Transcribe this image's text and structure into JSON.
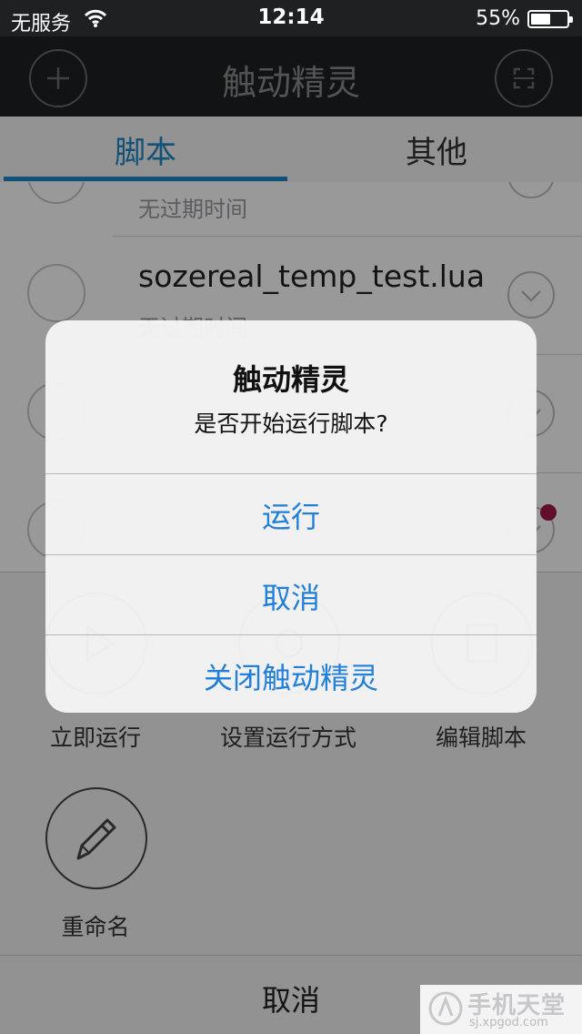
{
  "status_bar": {
    "carrier": "无服务",
    "time": "12:14",
    "battery_percent": "55%",
    "battery_level": 0.55
  },
  "nav": {
    "title": "触动精灵",
    "left_icon": "plus-icon",
    "right_icon": "scan-icon"
  },
  "tabs": [
    {
      "label": "脚本",
      "active": true
    },
    {
      "label": "其他",
      "active": false
    }
  ],
  "list": {
    "rows": [
      {
        "filename": "",
        "subtitle": "无过期时间"
      },
      {
        "filename": "sozereal_temp_test.lua",
        "subtitle": "无过期时间"
      },
      {
        "filename": "",
        "subtitle": ""
      },
      {
        "filename": "",
        "subtitle": ""
      }
    ]
  },
  "sheet": {
    "actions": [
      {
        "label": "立即运行",
        "icon": "run-icon"
      },
      {
        "label": "设置运行方式",
        "icon": "settings-icon"
      },
      {
        "label": "编辑脚本",
        "icon": "edit-script-icon"
      },
      {
        "label": "重命名",
        "icon": "pencil-icon"
      }
    ],
    "cancel_label": "取消"
  },
  "alert": {
    "title": "触动精灵",
    "message": "是否开始运行脚本?",
    "buttons": [
      "运行",
      "取消",
      "关闭触动精灵"
    ],
    "button_color": "#1f7fd9"
  },
  "watermark": {
    "name": "手机天堂",
    "url": "sj.xpgod.com"
  },
  "colors": {
    "accent": "#1e88c9",
    "navbar": "#1f2022",
    "badge": "#a0184a"
  }
}
